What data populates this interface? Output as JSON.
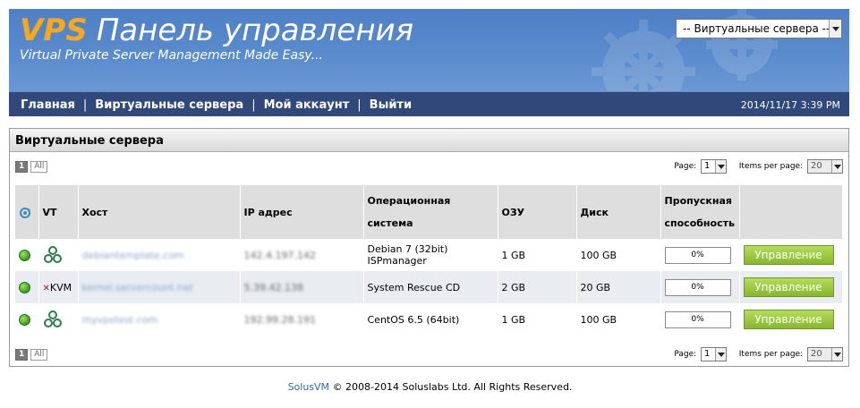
{
  "header": {
    "logo_prefix": "VPS",
    "logo_title": "Панель управления",
    "tagline": "Virtual Private Server Management Made Easy...",
    "server_select": "-- Виртуальные сервера --"
  },
  "nav": {
    "items": [
      "Главная",
      "Виртуальные сервера",
      "Мой аккаунт",
      "Выйти"
    ],
    "separator": "|",
    "datetime": "2014/11/17 3:39 PM"
  },
  "panel": {
    "title": "Виртуальные сервера",
    "pager": {
      "current": "1",
      "all": "All",
      "page_label": "Page:",
      "page_value": "1",
      "per_page_label": "Items per page:",
      "per_page_value": "20"
    }
  },
  "table": {
    "headers": [
      "VT",
      "Хост",
      "IP адрес",
      "Операционная система",
      "ОЗУ",
      "Диск",
      "Пропускная способность"
    ],
    "rows": [
      {
        "vt": "xen-icon",
        "host": "debiantemplate.com",
        "ip": "142.4.197.142",
        "os": "Debian 7 (32bit) ISPmanager",
        "ram": "1 GB",
        "disk": "100 GB",
        "bandwidth": "0%",
        "action": "Управление"
      },
      {
        "vt": "KVM",
        "host": "kernel.servercount.net",
        "ip": "5.39.42.138",
        "os": "System Rescue CD",
        "ram": "2 GB",
        "disk": "20 GB",
        "bandwidth": "0%",
        "action": "Управление"
      },
      {
        "vt": "xen-icon",
        "host": "myvpstest.com",
        "ip": "192.99.28.191",
        "os": "CentOS 6.5 (64bit)",
        "ram": "1 GB",
        "disk": "100 GB",
        "bandwidth": "0%",
        "action": "Управление"
      }
    ]
  },
  "footer": {
    "brand": "SolusVM",
    "copyright": "© 2008-2014 Soluslabs Ltd. All Rights Reserved."
  },
  "colors": {
    "header_blue": "#5b8ccd",
    "nav_blue": "#30487a",
    "logo_orange": "#f7a823",
    "manage_green": "#8fc23a",
    "status_green": "#3c9c1c"
  },
  "icons": {
    "status": "status-online-icon",
    "refresh": "refresh-icon",
    "xen": "xen-icon",
    "kvm": "kvm-icon"
  }
}
